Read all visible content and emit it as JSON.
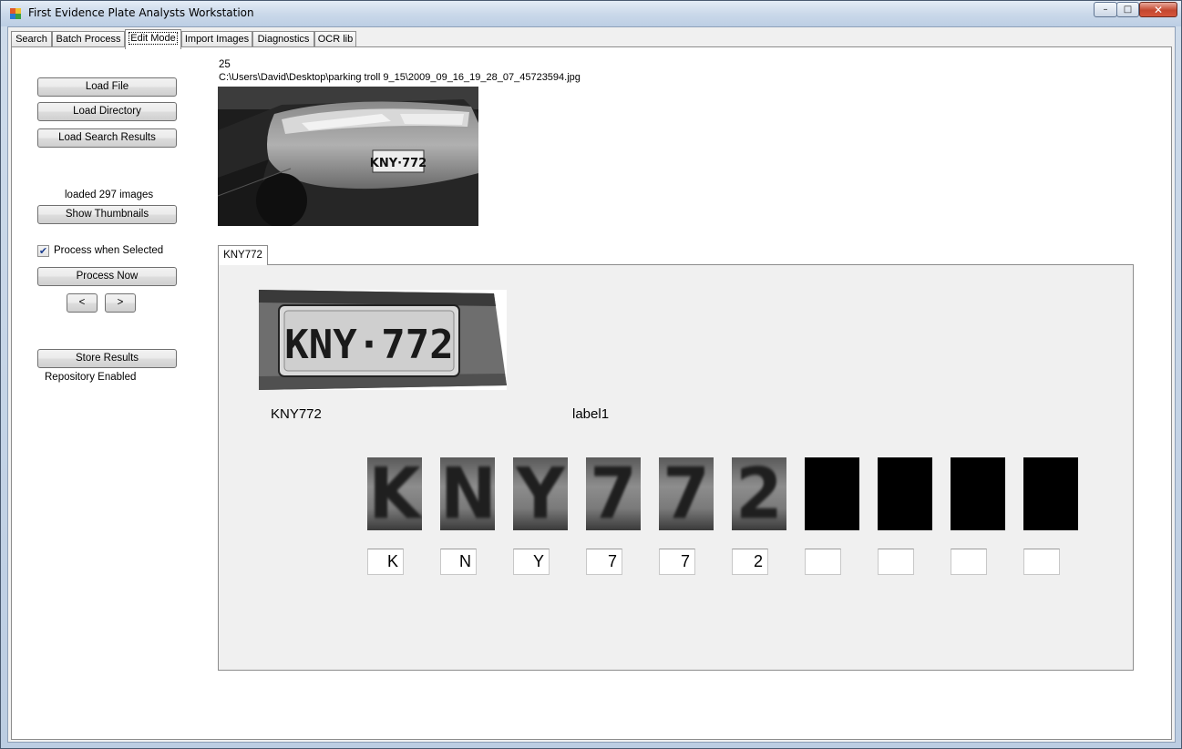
{
  "window": {
    "title": "First Evidence Plate Analysts Workstation",
    "buttons": {
      "minimize": "–",
      "maximize": "□",
      "close": "✕"
    }
  },
  "tabs": [
    {
      "label": "Search"
    },
    {
      "label": "Batch Process"
    },
    {
      "label": "Edit Mode"
    },
    {
      "label": "Import Images"
    },
    {
      "label": "Diagnostics"
    },
    {
      "label": "OCR lib"
    }
  ],
  "active_tab": "Edit Mode",
  "sidebar": {
    "load_file": "Load File",
    "load_directory": "Load Directory",
    "load_search_results": "Load Search Results",
    "loaded_status": "loaded 297 images",
    "show_thumbnails": "Show Thumbnails",
    "process_when_selected": {
      "label": "Process when Selected",
      "checked": true
    },
    "process_now": "Process Now",
    "prev": "<",
    "next": ">",
    "store_results": "Store Results",
    "repository_status": "Repository Enabled"
  },
  "image_info": {
    "index": "25",
    "path": "C:\\Users\\David\\Desktop\\parking troll 9_15\\2009_09_16_19_28_07_45723594.jpg"
  },
  "photo": {
    "plate_text": "KNY·772"
  },
  "plate_tab": {
    "label": "KNY772",
    "crop_text": "KNY·772",
    "plate_read": "KNY772",
    "label1": "label1",
    "glyphs": [
      "K",
      "N",
      "Y",
      "7",
      "7",
      "2",
      "",
      "",
      "",
      ""
    ],
    "chars": [
      "K",
      "N",
      "Y",
      "7",
      "7",
      "2",
      "",
      "",
      "",
      ""
    ]
  }
}
